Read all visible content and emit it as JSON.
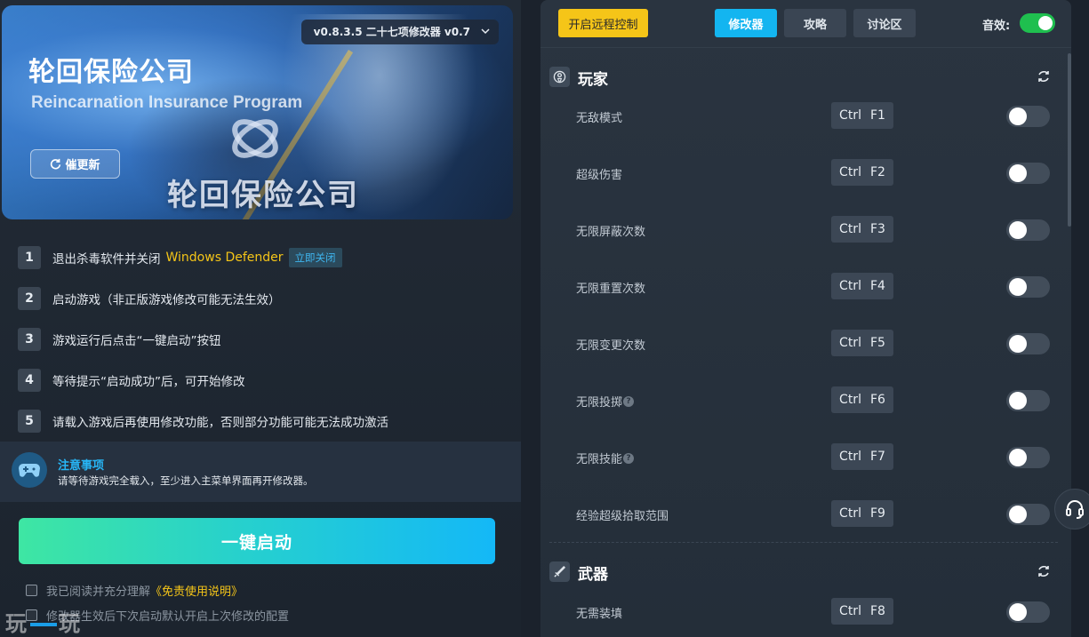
{
  "banner": {
    "title": "轮回保险公司",
    "subtitle": "Reincarnation Insurance Program",
    "logo_text": "轮回保险公司",
    "version": "v0.8.3.5 二十七项修改器 v0.7",
    "update_label": "催更新"
  },
  "steps": [
    {
      "num": "1",
      "text": "退出杀毒软件并关闭",
      "highlight": "Windows Defender",
      "button": "立即关闭"
    },
    {
      "num": "2",
      "text": "启动游戏（非正版游戏修改可能无法生效）"
    },
    {
      "num": "3",
      "text": "游戏运行后点击“一键启动”按钮"
    },
    {
      "num": "4",
      "text": "等待提示“启动成功”后，可开始修改"
    },
    {
      "num": "5",
      "text": "请载入游戏后再使用修改功能，否则部分功能可能无法成功激活"
    }
  ],
  "notice": {
    "title": "注意事项",
    "text": "请等待游戏完全载入，至少进入主菜单界面再开修改器。"
  },
  "launch_label": "一键启动",
  "agreement": {
    "prefix": "我已阅读并充分理解",
    "link": "《免责使用说明》"
  },
  "remember_label": "修改器生效后下次启动默认开启上次修改的配置",
  "watermark": {
    "left": "玩",
    "right": "玩"
  },
  "topbar": {
    "remote_label": "开启远程控制",
    "tabs": [
      "修改器",
      "攻略",
      "讨论区"
    ],
    "sound_label": "音效:"
  },
  "sections": [
    {
      "title": "玩家",
      "rows": [
        {
          "label": "无敌模式",
          "mod": "Ctrl",
          "key": "F1",
          "help": false
        },
        {
          "label": "超级伤害",
          "mod": "Ctrl",
          "key": "F2",
          "help": false
        },
        {
          "label": "无限屏蔽次数",
          "mod": "Ctrl",
          "key": "F3",
          "help": false
        },
        {
          "label": "无限重置次数",
          "mod": "Ctrl",
          "key": "F4",
          "help": false
        },
        {
          "label": "无限变更次数",
          "mod": "Ctrl",
          "key": "F5",
          "help": false
        },
        {
          "label": "无限投掷",
          "mod": "Ctrl",
          "key": "F6",
          "help": true
        },
        {
          "label": "无限技能",
          "mod": "Ctrl",
          "key": "F7",
          "help": true
        },
        {
          "label": "经验超级拾取范围",
          "mod": "Ctrl",
          "key": "F9",
          "help": false
        }
      ]
    },
    {
      "title": "武器",
      "rows": [
        {
          "label": "无需装填",
          "mod": "Ctrl",
          "key": "F8",
          "help": false
        }
      ]
    }
  ],
  "colors": {
    "accent": "#13b5f0",
    "highlight": "#f5c518",
    "sound_on": "#1fbf4f"
  }
}
